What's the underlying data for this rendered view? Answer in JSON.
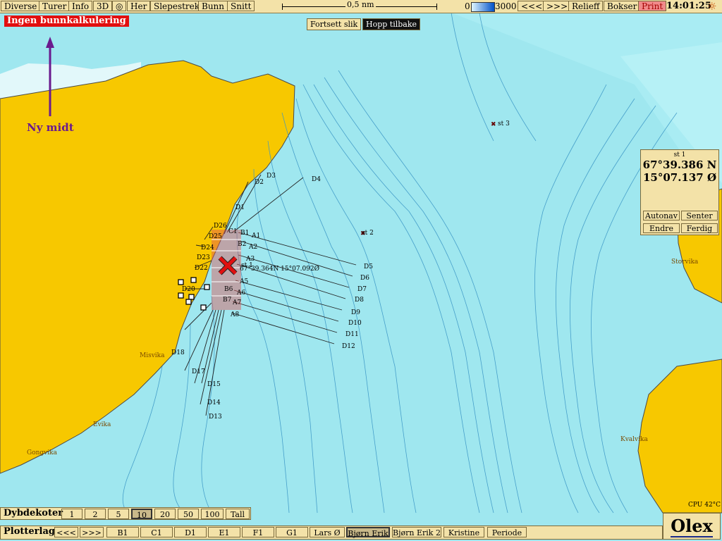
{
  "topbar": {
    "buttons": [
      "Diverse",
      "Turer",
      "Info",
      "3D",
      "Her",
      "Slepestrek",
      "Bunn",
      "Snitt"
    ],
    "scale_label": "0,5 nm",
    "depth_min": "0",
    "depth_max": "3000",
    "right_buttons": [
      "<<<",
      ">>>",
      "Relieff",
      "Bokser"
    ],
    "print": "Print",
    "time": "14:01:25"
  },
  "banner": "Ingen bunnkalkulering",
  "continue_btn": "Fortsett slik",
  "jump_back_btn": "Hopp tilbake",
  "ny_midt": "Ny midt",
  "info": {
    "station": "st 1",
    "lat": "67°39.386 N",
    "lon": "15°07.137 Ø",
    "buttons": [
      "Autonav",
      "Senter",
      "Endre",
      "Ferdig"
    ]
  },
  "cursor_coord": "67°39.364N 15°07.092Ø",
  "places": [
    "Misvika",
    "Evika",
    "Gongvika",
    "Storvika",
    "Kvalvika"
  ],
  "stations": [
    "st 1",
    "st 2",
    "st 3"
  ],
  "markers_A": [
    "A1",
    "A2",
    "A3",
    "A5",
    "A6",
    "A7",
    "A8"
  ],
  "markers_B": [
    "B1",
    "B2",
    "B6",
    "B7"
  ],
  "markers_C": [
    "C1"
  ],
  "markers_D": [
    "D1",
    "D2",
    "D3",
    "D4",
    "D5",
    "D6",
    "D7",
    "D8",
    "D9",
    "D10",
    "D11",
    "D12",
    "D13",
    "D14",
    "D15",
    "D17",
    "D18",
    "D20",
    "D22",
    "D23",
    "D24",
    "D25",
    "D26"
  ],
  "cpu": "CPU 42°C",
  "dybdekoter": {
    "label": "Dybdekoter",
    "buttons": [
      "1",
      "2",
      "5",
      "10",
      "20",
      "50",
      "100",
      "Tall"
    ],
    "selected": "10"
  },
  "plotterlag": {
    "label": "Plotterlag",
    "buttons": [
      "<<<",
      ">>>",
      "B1",
      "C1",
      "D1",
      "E1",
      "F1",
      "G1",
      "Lars Ø",
      "Bjørn Erik",
      "Bjørn Erik 2",
      "Kristine",
      "Periode"
    ],
    "selected": "Bjørn Erik"
  },
  "logo": "Olex",
  "colors": {
    "land": "#f7c800",
    "sea_deep": "#9fe7ef",
    "sea_shallow": "#ffffff",
    "panel": "#f3e2a8",
    "accent": "#e20f0f",
    "purple": "#6a1a8e"
  }
}
